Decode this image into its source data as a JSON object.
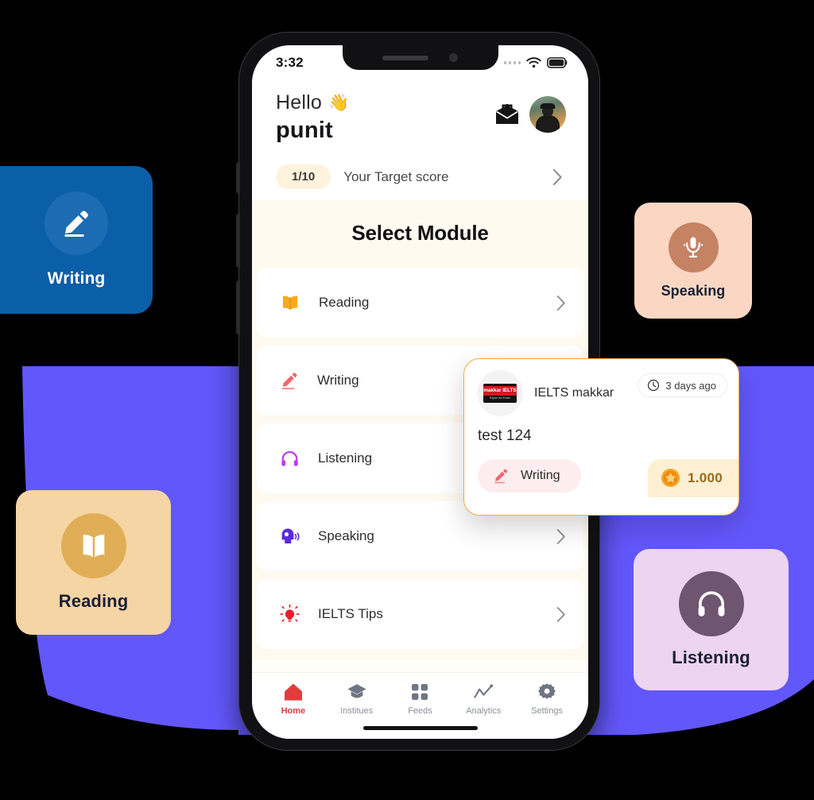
{
  "phone": {
    "status_bar": {
      "clock": "3:32",
      "wifi_icon": "wifi-icon",
      "battery_icon": "battery-icon",
      "signal_icon": "signal-dots-icon"
    },
    "header": {
      "greeting": "Hello",
      "wave_emoji": "👋",
      "username": "punit",
      "mail_icon": "mail-icon",
      "avatar_name": "user-avatar"
    },
    "target_score": {
      "badge": "1/10",
      "label": "Your Target score",
      "chevron": "chevron-right-icon"
    },
    "section_title": "Select Module",
    "modules": [
      {
        "label": "Reading",
        "icon": "open-book-icon",
        "color": "#FBA81C"
      },
      {
        "label": "Writing",
        "icon": "pencil-icon",
        "color": "#F2666C"
      },
      {
        "label": "Listening",
        "icon": "headphones-icon",
        "color": "#C23BF0"
      },
      {
        "label": "Speaking",
        "icon": "speaking-head-icon",
        "color": "#5B2BE0"
      },
      {
        "label": "IELTS Tips",
        "icon": "lightbulb-icon",
        "color": "#E5202A"
      }
    ],
    "bottom_nav": [
      {
        "label": "Home",
        "icon": "home-icon",
        "active": true
      },
      {
        "label": "Institues",
        "icon": "graduation-cap-icon",
        "active": false
      },
      {
        "label": "Feeds",
        "icon": "grid-icon",
        "active": false
      },
      {
        "label": "Analytics",
        "icon": "line-chart-icon",
        "active": false
      },
      {
        "label": "Settings",
        "icon": "gear-icon",
        "active": false
      }
    ]
  },
  "notification": {
    "logo_main": "makkar IELTS",
    "logo_sub": "Expert for Exam",
    "org_name": "IELTS makkar",
    "time_ago": "3 days ago",
    "clock_icon": "clock-icon",
    "title": "test 124",
    "tag_label": "Writing",
    "tag_icon": "pencil-icon",
    "coin_value": "1.000",
    "coin_icon": "star-coin-icon"
  },
  "floating_cards": [
    {
      "label": "Writing",
      "icon": "pencil-icon",
      "bg": "#0B5EA8",
      "circle": "#1C6CB3"
    },
    {
      "label": "Speaking",
      "icon": "microphone-icon",
      "bg": "#FBD7C3",
      "circle": "#C58363"
    },
    {
      "label": "Reading",
      "icon": "open-book-icon",
      "bg": "#F5D5A4",
      "circle": "#E0AE56"
    },
    {
      "label": "Listening",
      "icon": "headphones-icon",
      "bg": "#EDD4F0",
      "circle": "#6E5570"
    }
  ],
  "theme": {
    "blob_purple": "#6257FB",
    "accent_orange": "#F0A94C",
    "active_red": "#E23B3B"
  }
}
